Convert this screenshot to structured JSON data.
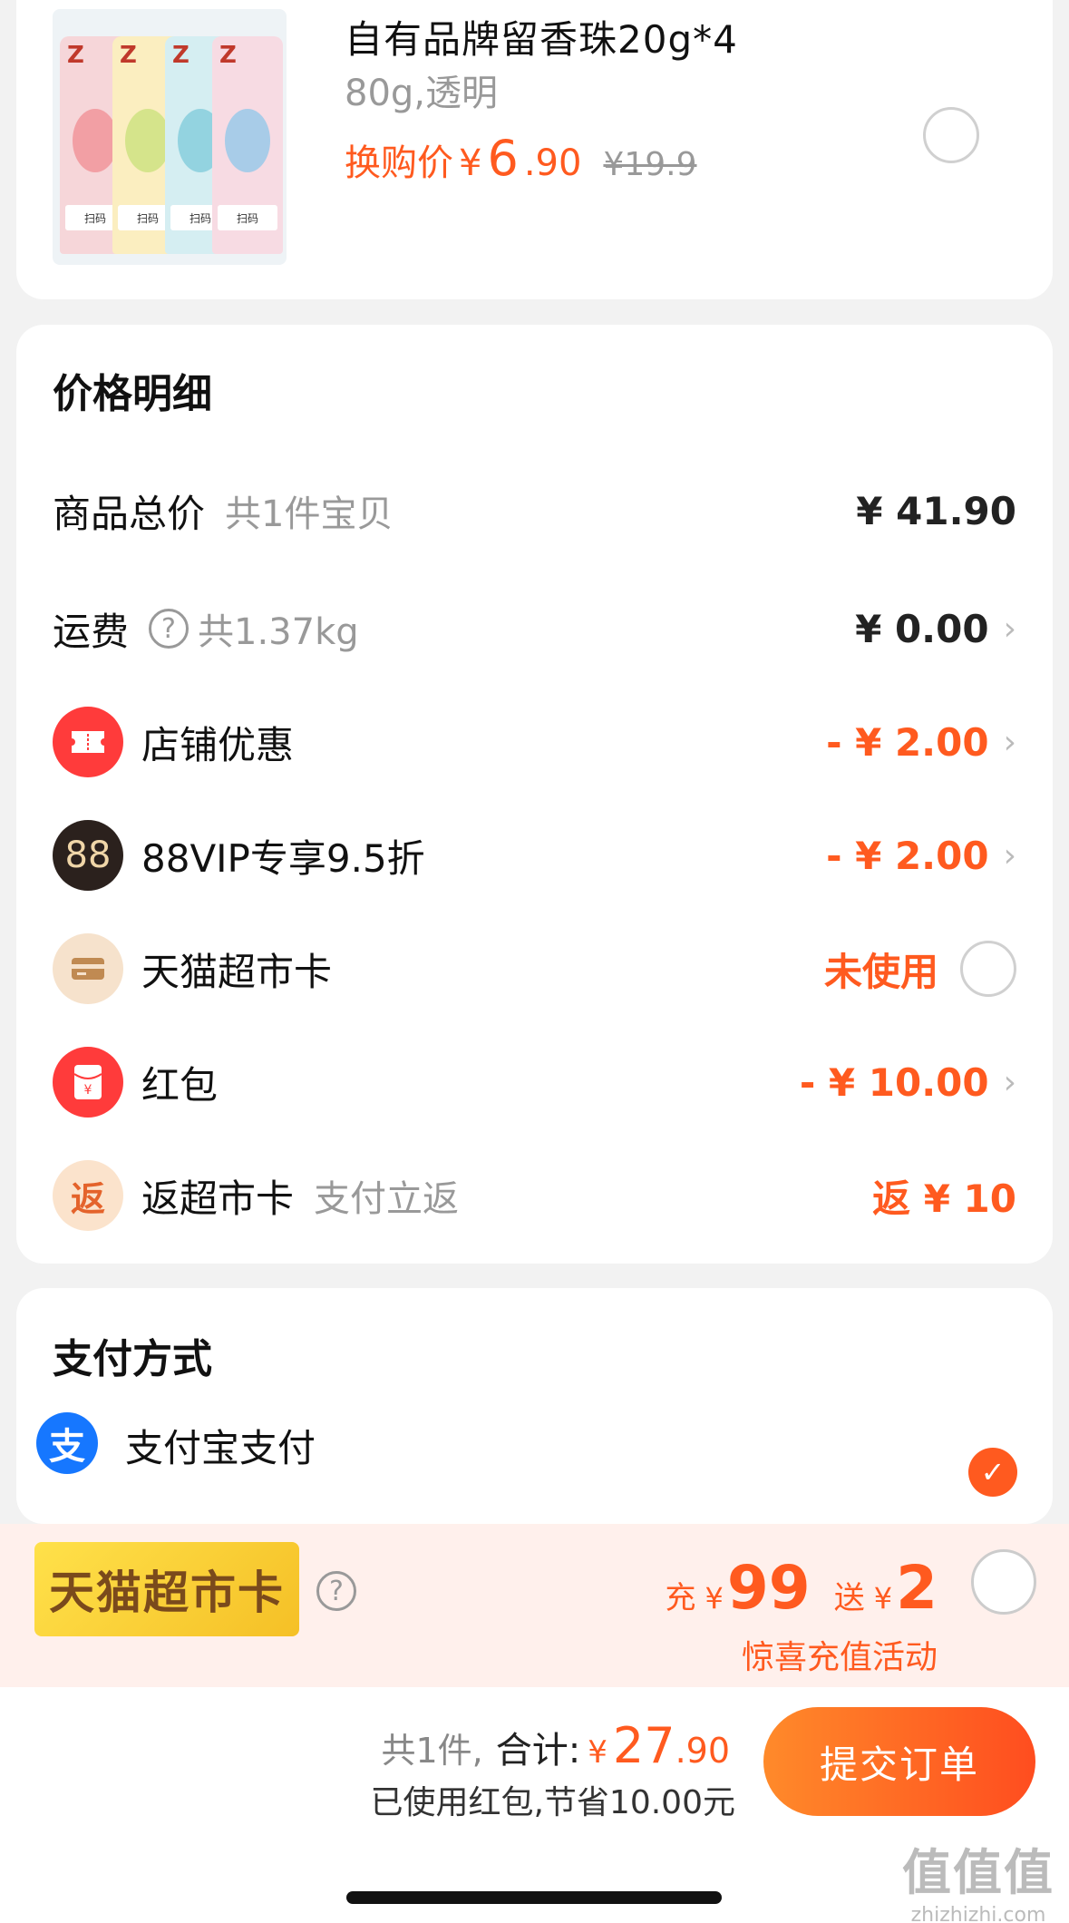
{
  "product": {
    "title": "自有品牌留香珠20g*4",
    "spec": "80g,透明",
    "price_label": "换购价",
    "price_symbol": "¥",
    "price_int": "6",
    "price_dec": ".90",
    "original_price": "¥19.9",
    "selected": false
  },
  "price_detail": {
    "title": "价格明细",
    "items_total": {
      "label": "商品总价",
      "sub": "共1件宝贝",
      "value": "¥ 41.90"
    },
    "shipping": {
      "label": "运费",
      "sub": "共1.37kg",
      "value": "¥ 0.00"
    },
    "store_discount": {
      "label": "店铺优惠",
      "value": "- ¥ 2.00"
    },
    "vip": {
      "label": "88VIP专享9.5折",
      "badge": "88",
      "value": "- ¥ 2.00"
    },
    "tmall_card": {
      "label": "天猫超市卡",
      "value": "未使用"
    },
    "red_packet": {
      "label": "红包",
      "value": "- ¥ 10.00"
    },
    "cashback": {
      "label": "返超市卡",
      "sub": "支付立返",
      "badge": "返",
      "value": "返 ¥ 10"
    }
  },
  "payment": {
    "title": "支付方式",
    "alipay_label": "支付宝支付",
    "alipay_icon": "支"
  },
  "promo": {
    "card_label": "天猫超市卡",
    "charge_word": "充",
    "charge_symbol": "¥",
    "charge_amount": "99",
    "gift_word": "送",
    "gift_symbol": "¥",
    "gift_amount": "2",
    "subtitle": "惊喜充值活动"
  },
  "summary": {
    "count": "共1件,",
    "total_label": "合计:",
    "symbol": "¥",
    "amount_int": "27",
    "amount_dec": ".90",
    "saved": "已使用红包,节省10.00元",
    "submit_label": "提交订单"
  },
  "watermark": {
    "line1": "值值值",
    "line2": "zhizhizhi.com"
  },
  "colors": {
    "accent": "#ff5a1f",
    "alipay": "#1677ff",
    "vip_bg": "#2b211d"
  }
}
